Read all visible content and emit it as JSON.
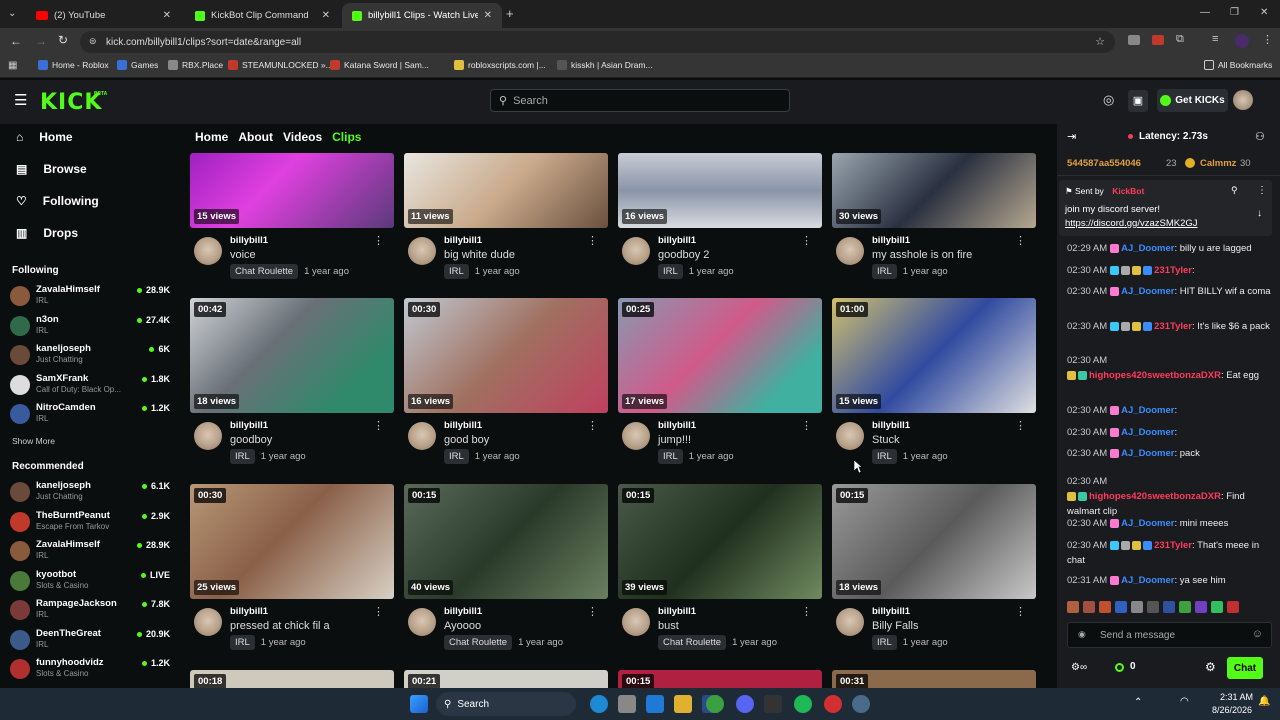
{
  "browser": {
    "tabs": [
      {
        "label": "(2) YouTube",
        "active": false
      },
      {
        "label": "KickBot Clip Command",
        "active": false
      },
      {
        "label": "billybill1 Clips - Watch Live on K",
        "active": true
      }
    ],
    "url": "kick.com/billybill1/clips?sort=date&range=all",
    "bookmarks": [
      "Home - Roblox",
      "Games",
      "RBX.Place",
      "STEAMUNLOCKED »...",
      "Katana Sword | Sam...",
      "robloxscripts.com |...",
      "kisskh | Asian Dram..."
    ],
    "all_bookmarks": "All Bookmarks"
  },
  "header": {
    "logo": "KICK",
    "beta": "BETA",
    "search_placeholder": "Search",
    "get_kicks": "Get KICKs"
  },
  "sidebar": {
    "nav": [
      {
        "label": "Home",
        "icon": "home-icon"
      },
      {
        "label": "Browse",
        "icon": "browse-icon"
      },
      {
        "label": "Following",
        "icon": "heart-icon"
      },
      {
        "label": "Drops",
        "icon": "drops-icon"
      }
    ],
    "following_title": "Following",
    "following": [
      {
        "name": "ZavalaHimself",
        "cat": "IRL",
        "viewers": "28.9K",
        "color": "#8a5a3c"
      },
      {
        "name": "n3on",
        "cat": "IRL",
        "viewers": "27.4K",
        "color": "#2f6b4a"
      },
      {
        "name": "kaneljoseph",
        "cat": "Just Chatting",
        "viewers": "6K",
        "color": "#6a4a3a"
      },
      {
        "name": "SamXFrank",
        "cat": "Call of Duty: Black Op...",
        "viewers": "1.8K",
        "color": "#ddd"
      },
      {
        "name": "NitroCamden",
        "cat": "IRL",
        "viewers": "1.2K",
        "color": "#3a5aa0"
      }
    ],
    "show_more": "Show More",
    "recommended_title": "Recommended",
    "recommended": [
      {
        "name": "kaneljoseph",
        "cat": "Just Chatting",
        "viewers": "6.1K",
        "color": "#6a4a3a"
      },
      {
        "name": "TheBurntPeanut",
        "cat": "Escape From Tarkov",
        "viewers": "2.9K",
        "color": "#c0392b"
      },
      {
        "name": "ZavalaHimself",
        "cat": "IRL",
        "viewers": "28.9K",
        "color": "#8a5a3c"
      },
      {
        "name": "kyootbot",
        "cat": "Slots & Casino",
        "viewers": "LIVE",
        "color": "#4a7a3a"
      },
      {
        "name": "RampageJackson",
        "cat": "IRL",
        "viewers": "7.8K",
        "color": "#7a3a3a"
      },
      {
        "name": "DeenTheGreat",
        "cat": "IRL",
        "viewers": "20.9K",
        "color": "#3a5a8a"
      },
      {
        "name": "funnyhoodvidz",
        "cat": "Slots & Casino",
        "viewers": "1.2K",
        "color": "#b03030"
      }
    ]
  },
  "main": {
    "tabs": [
      "Home",
      "About",
      "Videos",
      "Clips"
    ],
    "active_tab": "Clips",
    "clips": [
      {
        "dur": "",
        "views": "15 views",
        "user": "billybill1",
        "title": "voice",
        "tag": "Chat Roulette",
        "age": "1 year ago",
        "bg": "linear-gradient(135deg,#a020c0,#e040e0 40%,#5a3a7a)"
      },
      {
        "dur": "",
        "views": "11 views",
        "user": "billybill1",
        "title": "big white dude",
        "tag": "IRL",
        "age": "1 year ago",
        "bg": "linear-gradient(135deg,#e8e6e0,#c9a98a 50%,#6a5040)"
      },
      {
        "dur": "",
        "views": "16 views",
        "user": "billybill1",
        "title": "goodboy 2",
        "tag": "IRL",
        "age": "1 year ago",
        "bg": "linear-gradient(180deg,#c8ccd4,#8a95a8 50%,#d8dce0)"
      },
      {
        "dur": "",
        "views": "30 views",
        "user": "billybill1",
        "title": "my asshole is on fire",
        "tag": "IRL",
        "age": "1 year ago",
        "bg": "linear-gradient(135deg,#9aa6b0,#2a3040 50%,#b5a890)"
      },
      {
        "dur": "00:42",
        "views": "18 views",
        "user": "billybill1",
        "title": "goodboy",
        "tag": "IRL",
        "age": "1 year ago",
        "bg": "linear-gradient(135deg,#d0d4d8,#6a7078 40%,#2e8a6a 80%)"
      },
      {
        "dur": "00:30",
        "views": "16 views",
        "user": "billybill1",
        "title": "good boy",
        "tag": "IRL",
        "age": "1 year ago",
        "bg": "linear-gradient(135deg,#c0c8d0,#a07060 50%,#c04060)"
      },
      {
        "dur": "00:25",
        "views": "17 views",
        "user": "billybill1",
        "title": "jump!!!",
        "tag": "IRL",
        "age": "1 year ago",
        "bg": "linear-gradient(135deg,#8898b0,#d05a8a 45%,#40b0a0 80%)"
      },
      {
        "dur": "01:00",
        "views": "15 views",
        "user": "billybill1",
        "title": "Stuck",
        "tag": "IRL",
        "age": "1 year ago",
        "bg": "linear-gradient(135deg,#d0c070,#304aa0 50%,#e0e0e0)"
      },
      {
        "dur": "00:30",
        "views": "25 views",
        "user": "billybill1",
        "title": "pressed at chick fil a",
        "tag": "IRL",
        "age": "1 year ago",
        "bg": "linear-gradient(135deg,#b89878,#8a6048 45%,#d8d0c4)"
      },
      {
        "dur": "00:15",
        "views": "40 views",
        "user": "billybill1",
        "title": "Ayoooo",
        "tag": "Chat Roulette",
        "age": "1 year ago",
        "bg": "linear-gradient(135deg,#5a6a5a,#2a3a2a 50%,#6a8060)"
      },
      {
        "dur": "00:15",
        "views": "39 views",
        "user": "billybill1",
        "title": "bust",
        "tag": "Chat Roulette",
        "age": "1 year ago",
        "bg": "linear-gradient(135deg,#4a5a4a,#20301e 50%,#708a60)"
      },
      {
        "dur": "00:15",
        "views": "18 views",
        "user": "billybill1",
        "title": "Billy Falls",
        "tag": "IRL",
        "age": "1 year ago",
        "bg": "linear-gradient(135deg,#9a9a9a,#5a5a5a 50%,#c8c8c8)"
      }
    ],
    "partial_durs": [
      "00:18",
      "00:21",
      "00:15",
      "00:31"
    ]
  },
  "chat": {
    "latency": "Latency: 2.73s",
    "top_user1": "544587aa554046",
    "top_user1_count": "23",
    "top_user2": "Calmmz",
    "top_user2_count": "30",
    "pinned_sent_by": "Sent by",
    "pinned_bot": "KickBot",
    "pinned_text": "join my discord server!",
    "pinned_link": "https://discord.gg/vzazSMK2GJ",
    "messages": [
      {
        "t": "02:29 AM",
        "u": "AJ_Doomer",
        "c": "#3b8dff",
        "m": ": billy u are lagged"
      },
      {
        "t": "02:30 AM",
        "u": "231Tyler",
        "c": "#ff3b5c",
        "m": ":"
      },
      {
        "t": "02:30 AM",
        "u": "AJ_Doomer",
        "c": "#3b8dff",
        "m": ": HIT BILLY wif a coma"
      },
      {
        "t": "02:30 AM",
        "u": "231Tyler",
        "c": "#ff3b5c",
        "m": ": It's like $6 a pack"
      },
      {
        "t": "02:30 AM",
        "u": "highopes420sweetbonzaDXR",
        "c": "#ff3b5c",
        "m": ": Eat egg"
      },
      {
        "t": "02:30 AM",
        "u": "AJ_Doomer",
        "c": "#3b8dff",
        "m": ":"
      },
      {
        "t": "02:30 AM",
        "u": "AJ_Doomer",
        "c": "#3b8dff",
        "m": ":"
      },
      {
        "t": "02:30 AM",
        "u": "AJ_Doomer",
        "c": "#3b8dff",
        "m": ": pack"
      },
      {
        "t": "02:30 AM",
        "u": "highopes420sweetbonzaDXR",
        "c": "#ff3b5c",
        "m": ": Find walmart clip"
      },
      {
        "t": "02:30 AM",
        "u": "AJ_Doomer",
        "c": "#3b8dff",
        "m": ": mini meees"
      },
      {
        "t": "02:30 AM",
        "u": "231Tyler",
        "c": "#ff3b5c",
        "m": ": That's meee in chat"
      },
      {
        "t": "02:31 AM",
        "u": "AJ_Doomer",
        "c": "#3b8dff",
        "m": ": ya see him"
      }
    ],
    "input_placeholder": "Send a message",
    "points": "0",
    "chat_button": "Chat"
  },
  "taskbar": {
    "search": "Search",
    "time": "2:31 AM",
    "date": "8/26/2026"
  }
}
